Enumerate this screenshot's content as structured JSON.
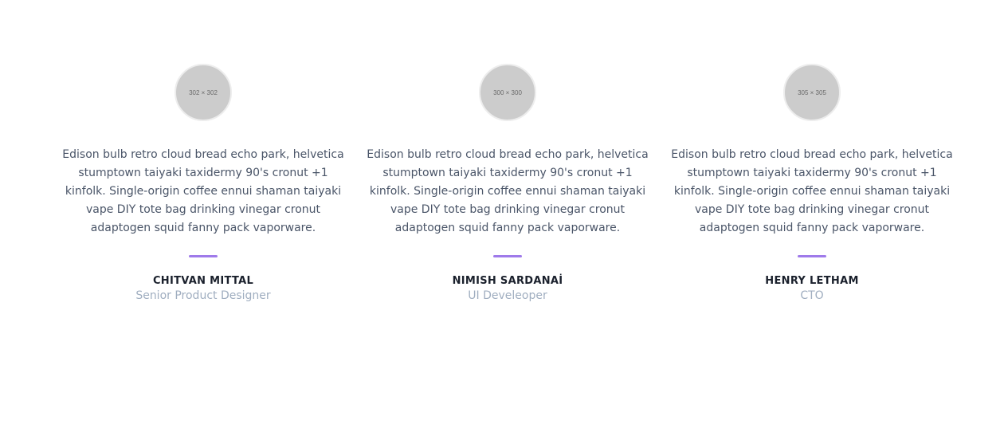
{
  "testimonials": [
    {
      "avatar_placeholder": "302 × 302",
      "quote": "Edison bulb retro cloud bread echo park, helvetica stumptown taiyaki taxidermy 90's cronut +1 kinfolk. Single-origin coffee ennui shaman taiyaki vape DIY tote bag drinking vinegar cronut adaptogen squid fanny pack vaporware.",
      "name": "CHITVAN MITTAL",
      "role": "Senior Product Designer"
    },
    {
      "avatar_placeholder": "300 × 300",
      "quote": "Edison bulb retro cloud bread echo park, helvetica stumptown taiyaki taxidermy 90's cronut +1 kinfolk. Single-origin coffee ennui shaman taiyaki vape DIY tote bag drinking vinegar cronut adaptogen squid fanny pack vaporware.",
      "name": "NIMISH SARDANAİ",
      "role": "UI Develeoper"
    },
    {
      "avatar_placeholder": "305 × 305",
      "quote": "Edison bulb retro cloud bread echo park, helvetica stumptown taiyaki taxidermy 90's cronut +1 kinfolk. Single-origin coffee ennui shaman taiyaki vape DIY tote bag drinking vinegar cronut adaptogen squid fanny pack vaporware.",
      "name": "HENRY LETHAM",
      "role": "CTO"
    }
  ],
  "colors": {
    "accent": "#9f7aea",
    "quote_text": "#4a5568",
    "name_text": "#1a202c",
    "role_text": "#a0aec0",
    "avatar_bg": "#cccccc"
  }
}
